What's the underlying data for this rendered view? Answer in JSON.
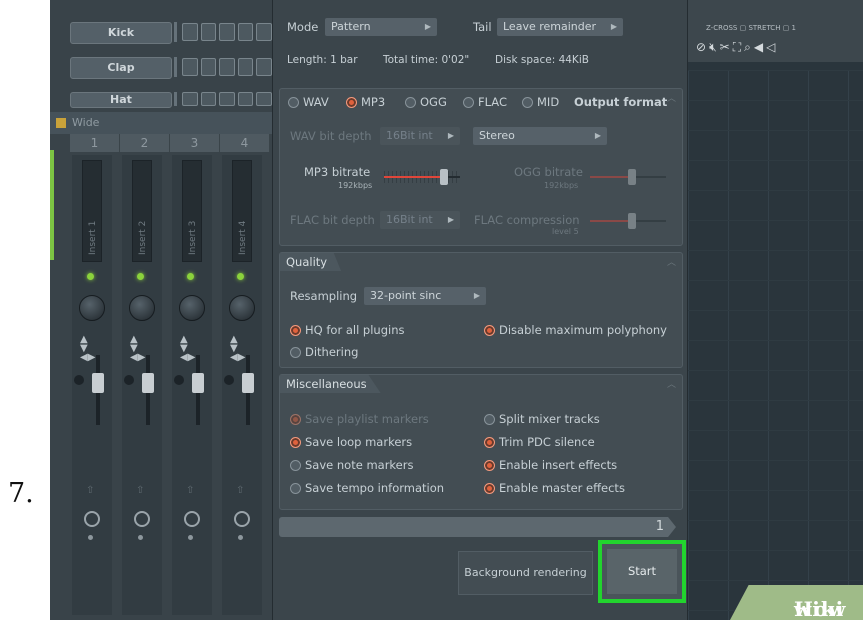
{
  "step_number": "7.",
  "mixer": {
    "channels": [
      "Kick",
      "Clap",
      "Hat"
    ],
    "preset": "Wide",
    "track_numbers": [
      "1",
      "2",
      "3",
      "4"
    ],
    "inserts": [
      "Insert 1",
      "Insert 2",
      "Insert 3",
      "Insert 4"
    ]
  },
  "playlist": {
    "zcross_label": "Z-CROSS",
    "stretch_label": "STRETCH",
    "value": "1"
  },
  "dialog": {
    "mode_label": "Mode",
    "mode_value": "Pattern",
    "tail_label": "Tail",
    "tail_value": "Leave remainder",
    "length": "Length: 1 bar",
    "total_time": "Total time: 0'02\"",
    "disk_space": "Disk space: 44KiB",
    "output_format": {
      "title": "Output format",
      "formats": [
        "WAV",
        "MP3",
        "OGG",
        "FLAC",
        "MID"
      ],
      "selected": "MP3",
      "wav_bit_depth_label": "WAV bit depth",
      "wav_bit_depth_value": "16Bit int",
      "channels_value": "Stereo",
      "mp3_bitrate_label": "MP3 bitrate",
      "mp3_bitrate_value": "192kbps",
      "ogg_bitrate_label": "OGG bitrate",
      "ogg_bitrate_value": "192kbps",
      "flac_bit_depth_label": "FLAC bit depth",
      "flac_bit_depth_value": "16Bit int",
      "flac_compression_label": "FLAC compression",
      "flac_compression_value": "level 5"
    },
    "quality": {
      "title": "Quality",
      "resampling_label": "Resampling",
      "resampling_value": "32-point sinc",
      "hq_all_plugins": "HQ for all plugins",
      "disable_max_polyphony": "Disable maximum polyphony",
      "dithering": "Dithering"
    },
    "misc": {
      "title": "Miscellaneous",
      "save_playlist_markers": "Save playlist markers",
      "save_loop_markers": "Save loop markers",
      "save_note_markers": "Save note markers",
      "save_tempo_information": "Save tempo information",
      "split_mixer_tracks": "Split mixer tracks",
      "trim_pdc_silence": "Trim PDC silence",
      "enable_insert_effects": "Enable insert effects",
      "enable_master_effects": "Enable master effects"
    },
    "progress_value": "1",
    "background_rendering": "Background rendering",
    "start": "Start"
  },
  "watermark": {
    "wiki": "wiki",
    "how": "How"
  },
  "colors": {
    "accent_orange": "#e0623d",
    "highlight_green": "#22d42e",
    "led_green": "#8bd23c"
  }
}
